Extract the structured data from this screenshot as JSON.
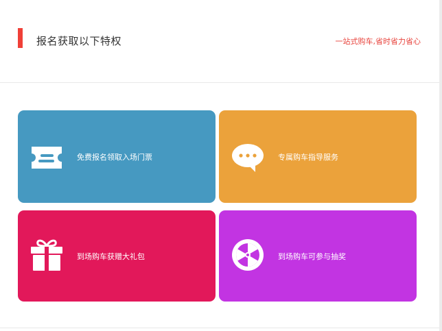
{
  "header": {
    "title": "报名获取以下特权",
    "slogan": "一站式购车,省时省力省心",
    "accent_color": "#f04038"
  },
  "cards": [
    {
      "label": "免费报名领取入场门票",
      "icon": "ticket-icon",
      "color": "#4699c1"
    },
    {
      "label": "专属购车指导服务",
      "icon": "chat-bubble-icon",
      "color": "#eba23b"
    },
    {
      "label": "到场购车获赠大礼包",
      "icon": "gift-icon",
      "color": "#e2185a"
    },
    {
      "label": "到场购车可参与抽奖",
      "icon": "lottery-wheel-icon",
      "color": "#c234e2"
    }
  ]
}
